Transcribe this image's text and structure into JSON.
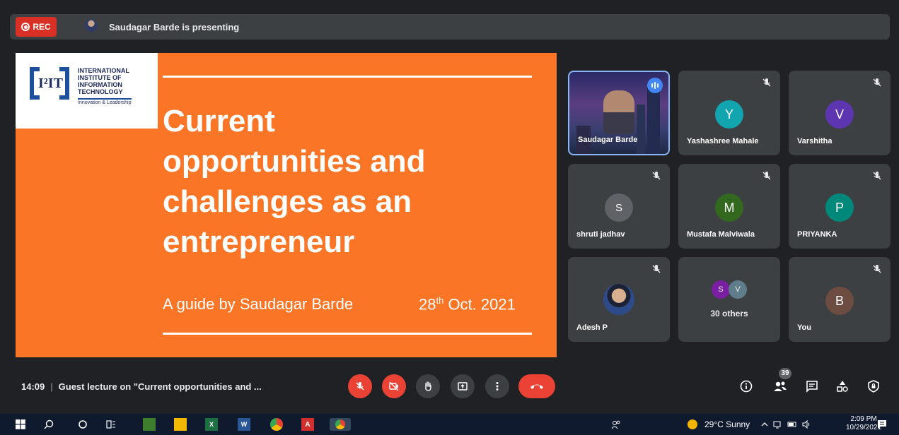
{
  "topbar": {
    "rec_label": "REC",
    "presenting_text": "Saudagar Barde is presenting"
  },
  "slide": {
    "logo_lines": [
      "INTERNATIONAL",
      "INSTITUTE OF",
      "INFORMATION",
      "TECHNOLOGY"
    ],
    "logo_mark": "I²IT",
    "logo_tagline": "Innovation & Leadership",
    "title": "Current\nopportunities and\nchallenges as an\nentrepreneur",
    "subtitle": "A guide by Saudagar Barde",
    "date_day": "28",
    "date_suffix": "th",
    "date_rest": " Oct. 2021",
    "background_color": "#fa7526"
  },
  "participants": [
    {
      "name": "Saudagar Barde",
      "type": "video",
      "speaking": true
    },
    {
      "name": "Yashashree Mahale",
      "initial": "Y",
      "color": "#12a4af",
      "muted": true
    },
    {
      "name": "Varshitha",
      "initial": "V",
      "color": "#5e35b1",
      "muted": true
    },
    {
      "name": "shruti jadhav",
      "initial": "S",
      "color": "#5f6368",
      "muted": true
    },
    {
      "name": "Mustafa Malviwala",
      "initial": "M",
      "color": "#33691e",
      "muted": true
    },
    {
      "name": "PRIYANKA",
      "initial": "P",
      "color": "#00897b",
      "muted": true
    },
    {
      "name": "Adesh P",
      "type": "photo",
      "muted": true
    },
    {
      "others_label": "30 others",
      "initials": [
        "S",
        "V"
      ]
    },
    {
      "name": "You",
      "initial": "B",
      "color": "#6d4c41",
      "muted": true
    }
  ],
  "bottombar": {
    "time": "14:09",
    "meeting_title": "Guest lecture on \"Current opportunities and ...",
    "people_count": "39"
  },
  "controls": [
    "mic-off",
    "camera-off",
    "raise-hand",
    "present-screen",
    "more-options",
    "leave-call"
  ],
  "right_controls": [
    "meeting-details",
    "people",
    "chat",
    "activities",
    "host-controls"
  ],
  "taskbar": {
    "weather": "29°C  Sunny",
    "time": "2:09 PM",
    "date": "10/29/2021"
  }
}
